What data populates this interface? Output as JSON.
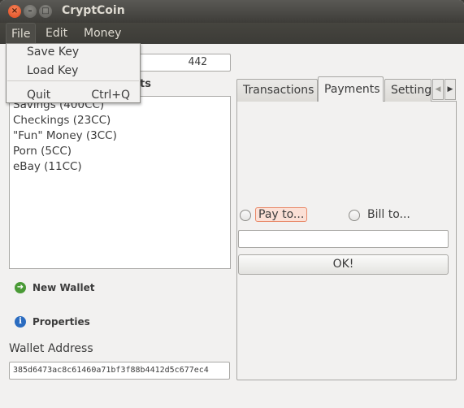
{
  "window": {
    "title": "CryptCoin",
    "controls": [
      "×",
      "–",
      "□"
    ]
  },
  "menubar": {
    "file": "File",
    "edit": "Edit",
    "money": "Money"
  },
  "file_menu": {
    "items": [
      "Save Key",
      "Load Key",
      "Quit"
    ],
    "quit_shortcut": "Ctrl+Q"
  },
  "balance": {
    "value": "442"
  },
  "accounts": {
    "label_visible": "ts"
  },
  "wallets": [
    "Savings (400CC)",
    "Checkings (23CC)",
    "\"Fun\" Money (3CC)",
    "Porn (5CC)",
    "eBay (11CC)"
  ],
  "actions": {
    "new_wallet": "New Wallet",
    "properties": "Properties"
  },
  "wallet_address": {
    "label": "Wallet Address",
    "value": "385d6473ac8c61460a71bf3f88b4412d5c677ec4"
  },
  "tabs": {
    "items": [
      "Transactions",
      "Payments",
      "Setting"
    ],
    "active": "Payments",
    "arrow_left": "◀",
    "arrow_right": "▶"
  },
  "payments": {
    "pay_to": "Pay to...",
    "bill_to": "Bill to...",
    "input_value": "",
    "ok": "OK!"
  }
}
